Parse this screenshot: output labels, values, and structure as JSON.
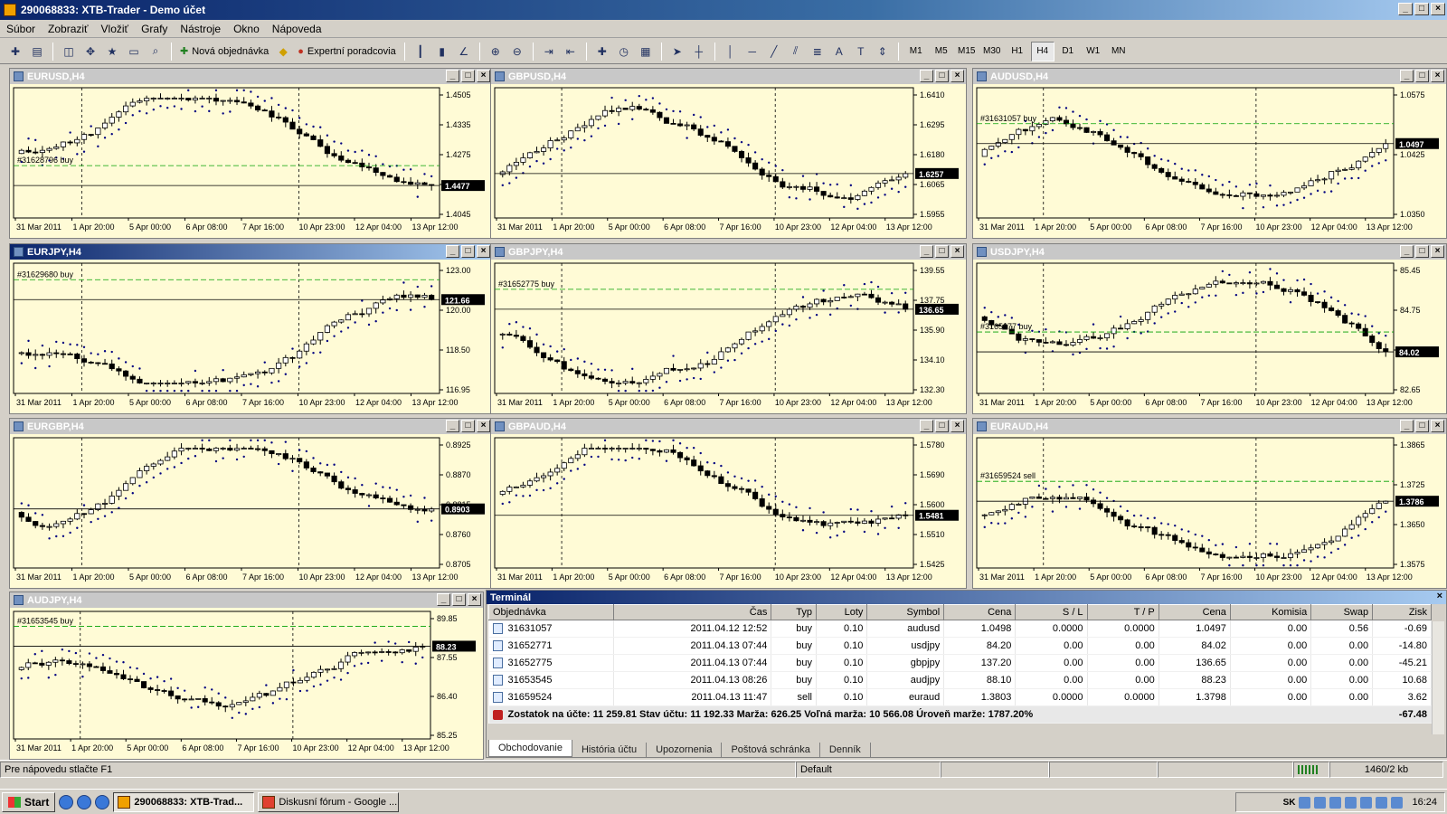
{
  "window": {
    "title": "290068833: XTB-Trader - Demo účet"
  },
  "menu": [
    "Súbor",
    "Zobraziť",
    "Vložiť",
    "Grafy",
    "Nástroje",
    "Okno",
    "Nápoveda"
  ],
  "toolbar": {
    "new_order": "Nová objednávka",
    "expert": "Expertní poradcovia",
    "timeframes": [
      "M1",
      "M5",
      "M15",
      "M30",
      "H1",
      "H4",
      "D1",
      "W1",
      "MN"
    ],
    "active_timeframe": "H4"
  },
  "charts": [
    {
      "title": "EURUSD,H4",
      "prices": [
        "1.4505",
        "1.4335",
        "1.4275",
        "1.4160",
        "1.4045"
      ],
      "marker": "#31628796 buy",
      "bid": "1.4477",
      "active": false
    },
    {
      "title": "GBPUSD,H4",
      "prices": [
        "1.6410",
        "1.6295",
        "1.6180",
        "1.6065",
        "1.5955"
      ],
      "marker": "",
      "bid": "1.6257",
      "active": false
    },
    {
      "title": "AUDUSD,H4",
      "prices": [
        "1.0575",
        "1.0425",
        "1.0350"
      ],
      "marker": "#31631057 buy",
      "bid": "1.0497",
      "active": false
    },
    {
      "title": "EURJPY,H4",
      "prices": [
        "123.00",
        "120.00",
        "118.50",
        "116.95"
      ],
      "marker": "#31629680 buy",
      "bid": "121.66",
      "active": true
    },
    {
      "title": "GBPJPY,H4",
      "prices": [
        "139.55",
        "137.75",
        "135.90",
        "134.10",
        "132.30"
      ],
      "marker": "#31652775 buy",
      "bid": "136.65",
      "active": false
    },
    {
      "title": "USDJPY,H4",
      "prices": [
        "85.45",
        "84.75",
        "83.35",
        "82.65"
      ],
      "marker": "#3165277 buy",
      "bid": "84.02",
      "active": false
    },
    {
      "title": "EURGBP,H4",
      "prices": [
        "0.8925",
        "0.8870",
        "0.8815",
        "0.8760",
        "0.8705"
      ],
      "marker": "",
      "bid": "0.8903",
      "active": false
    },
    {
      "title": "GBPAUD,H4",
      "prices": [
        "1.5780",
        "1.5690",
        "1.5600",
        "1.5510",
        "1.5425"
      ],
      "marker": "",
      "bid": "1.5481",
      "active": false
    },
    {
      "title": "EURAUD,H4",
      "prices": [
        "1.3865",
        "1.3725",
        "1.3650",
        "1.3575"
      ],
      "marker": "#31659524 sell",
      "bid": "1.3786",
      "active": false
    },
    {
      "title": "AUDJPY,H4",
      "prices": [
        "89.85",
        "87.55",
        "86.40",
        "85.25"
      ],
      "marker": "#31653545 buy",
      "bid": "88.23",
      "active": false
    }
  ],
  "time_labels": [
    "31 Mar 2011",
    "1 Apr 20:00",
    "5 Apr 00:00",
    "6 Apr 08:00",
    "7 Apr 16:00",
    "10 Apr 23:00",
    "12 Apr 04:00",
    "13 Apr 12:00"
  ],
  "terminal": {
    "title": "Terminál",
    "columns": [
      "Objednávka",
      "Čas",
      "Typ",
      "Loty",
      "Symbol",
      "Cena",
      "S / L",
      "T / P",
      "Cena",
      "Komisia",
      "Swap",
      "Zisk"
    ],
    "rows": [
      [
        "31631057",
        "2011.04.12 12:52",
        "buy",
        "0.10",
        "audusd",
        "1.0498",
        "0.0000",
        "0.0000",
        "1.0497",
        "0.00",
        "0.56",
        "-0.69"
      ],
      [
        "31652771",
        "2011.04.13 07:44",
        "buy",
        "0.10",
        "usdjpy",
        "84.20",
        "0.00",
        "0.00",
        "84.02",
        "0.00",
        "0.00",
        "-14.80"
      ],
      [
        "31652775",
        "2011.04.13 07:44",
        "buy",
        "0.10",
        "gbpjpy",
        "137.20",
        "0.00",
        "0.00",
        "136.65",
        "0.00",
        "0.00",
        "-45.21"
      ],
      [
        "31653545",
        "2011.04.13 08:26",
        "buy",
        "0.10",
        "audjpy",
        "88.10",
        "0.00",
        "0.00",
        "88.23",
        "0.00",
        "0.00",
        "10.68"
      ],
      [
        "31659524",
        "2011.04.13 11:47",
        "sell",
        "0.10",
        "euraud",
        "1.3803",
        "0.0000",
        "0.0000",
        "1.3798",
        "0.00",
        "0.00",
        "3.62"
      ]
    ],
    "summary": "Zostatok na účte: 11 259.81  Stav účtu: 11 192.33  Marža: 626.25  Voľná marža: 10 566.08  Úroveň marže: 1787.20%",
    "summary_total": "-67.48",
    "tabs": [
      "Obchodovanie",
      "História účtu",
      "Upozornenia",
      "Poštová schránka",
      "Denník"
    ]
  },
  "status": {
    "help": "Pre nápovedu stlačte F1",
    "profile": "Default",
    "traffic": "1460/2 kb"
  },
  "taskbar": {
    "start": "Start",
    "items": [
      "290068833: XTB-Trad...",
      "Diskusní fórum - Google ..."
    ],
    "clock": "16:24",
    "lang": "SK"
  }
}
